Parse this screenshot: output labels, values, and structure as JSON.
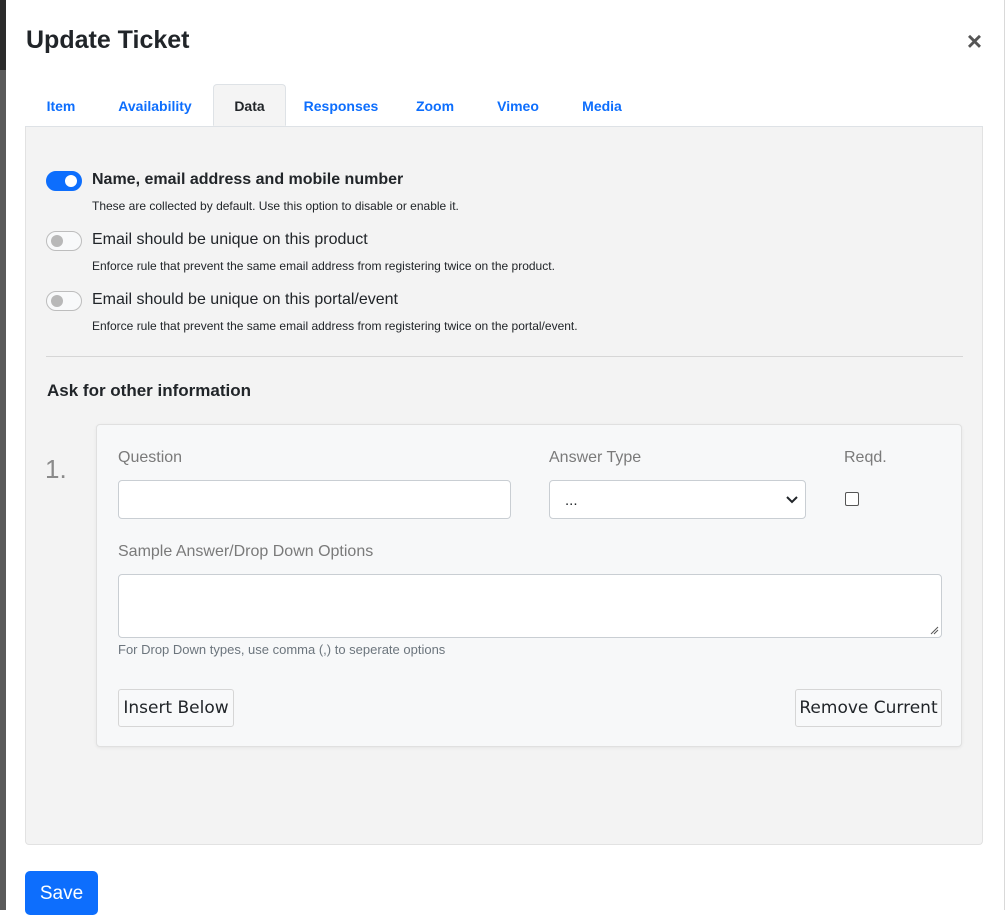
{
  "modal": {
    "title": "Update Ticket",
    "close_glyph": "×"
  },
  "tabs": [
    {
      "label": "Item",
      "active": false
    },
    {
      "label": "Availability",
      "active": false
    },
    {
      "label": "Data",
      "active": true
    },
    {
      "label": "Responses",
      "active": false
    },
    {
      "label": "Zoom",
      "active": false
    },
    {
      "label": "Vimeo",
      "active": false
    },
    {
      "label": "Media",
      "active": false
    }
  ],
  "options": [
    {
      "title": "Name, email address and mobile number",
      "description": "These are collected by default. Use this option to disable or enable it.",
      "enabled": true
    },
    {
      "title": "Email should be unique on this product",
      "description": "Enforce rule that prevent the same email address from registering twice on the product.",
      "enabled": false
    },
    {
      "title": "Email should be unique on this portal/event",
      "description": "Enforce rule that prevent the same email address from registering twice on the portal/event.",
      "enabled": false
    }
  ],
  "other_info": {
    "title": "Ask for other information",
    "question_number": "1.",
    "question_label": "Question",
    "question_value": "",
    "answer_type_label": "Answer Type",
    "answer_type_value": "...",
    "required_label": "Reqd.",
    "required_checked": false,
    "sample_label": "Sample Answer/Drop Down Options",
    "sample_value": "",
    "sample_help": "For Drop Down types, use comma (,) to seperate options",
    "insert_below_label": "Insert Below",
    "remove_current_label": "Remove Current"
  },
  "footer": {
    "save_label": "Save"
  },
  "colors": {
    "accent": "#0d6efd",
    "panel_bg": "#f3f3f3"
  }
}
